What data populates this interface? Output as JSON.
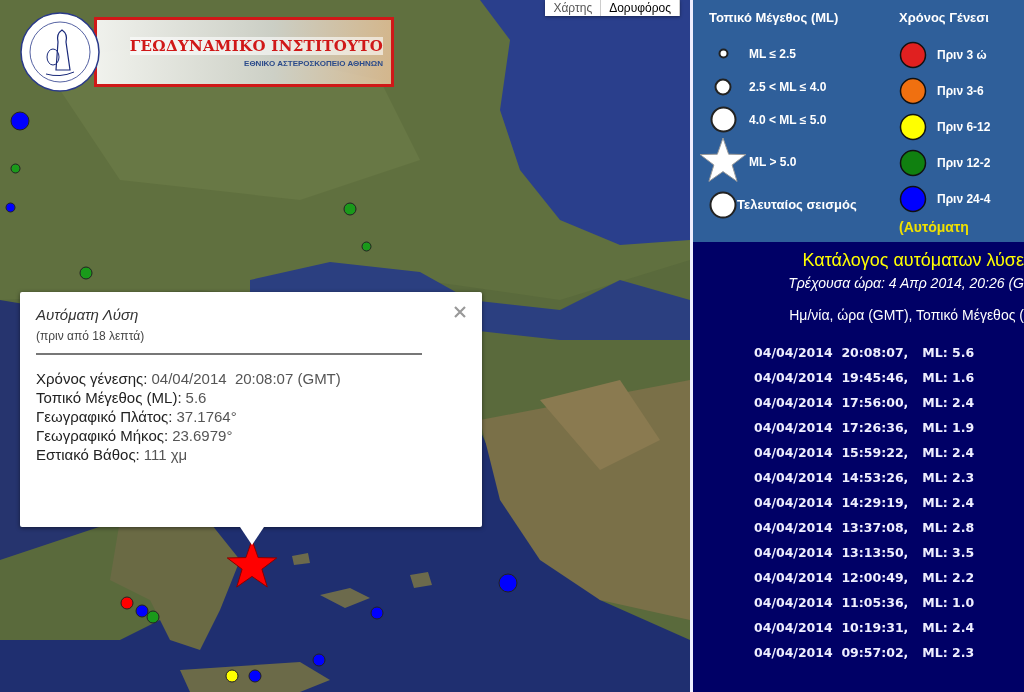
{
  "map": {
    "map_types": [
      {
        "label": "Χάρτης",
        "selected": false
      },
      {
        "label": "Δορυφόρος",
        "selected": true
      }
    ],
    "logo": {
      "title": "ΓΕΩΔΥΝΑΜΙΚΟ ΙΝΣΤΙΤΟΥΤΟ",
      "subtitle": "ΕΘΝΙΚΟ ΑΣΤΕΡΟΣΚΟΠΕΙΟ ΑΘΗΝΩΝ"
    },
    "markers": [
      {
        "kind": "large",
        "color": "#0000ff"
      },
      {
        "kind": "small",
        "color": "#1a9a1a"
      },
      {
        "kind": "small",
        "color": "#0000ff"
      },
      {
        "kind": "medium",
        "color": "#1a9a1a"
      },
      {
        "kind": "small",
        "color": "#1a9a1a"
      },
      {
        "kind": "medium",
        "color": "#1a9a1a"
      },
      {
        "kind": "large",
        "color": "#0000ff"
      },
      {
        "kind": "medium",
        "color": "#ff0000"
      },
      {
        "kind": "medium",
        "color": "#0000ff"
      },
      {
        "kind": "medium",
        "color": "#1a9a1a"
      },
      {
        "kind": "medium",
        "color": "#0000ff"
      },
      {
        "kind": "medium",
        "color": "#0000ff"
      },
      {
        "kind": "medium",
        "color": "#0000ff"
      },
      {
        "kind": "medium",
        "color": "#ffff00"
      },
      {
        "kind": "star",
        "color": "#ff0000"
      }
    ],
    "popup": {
      "title": "Αυτόματη Λύση",
      "subtitle": "(πριν από 18 λεπτά)",
      "fields": [
        {
          "label": "Χρόνος γένεσης:",
          "value": "04/04/2014  20:08:07 (GMT)"
        },
        {
          "label": "Τοπικό Μέγεθος (ML):",
          "value": "5.6"
        },
        {
          "label": "Γεωγραφικό Πλάτος:",
          "value": "37.1764°"
        },
        {
          "label": "Γεωγραφικό Μήκος:",
          "value": "23.6979°"
        },
        {
          "label": "Εστιακό Βάθος:",
          "value": "111 χμ"
        }
      ]
    }
  },
  "legend": {
    "magnitude_title": "Τοπικό Μέγεθος (ML)",
    "magnitudes": [
      {
        "kind": "small",
        "label": "ML ≤ 2.5"
      },
      {
        "kind": "medium",
        "label": "2.5 < ML ≤ 4.0"
      },
      {
        "kind": "large",
        "label": "4.0 < ML ≤ 5.0"
      },
      {
        "kind": "star",
        "label": "ML > 5.0"
      }
    ],
    "latest": "Τελευταίος σεισμός",
    "age_title": "Χρόνος Γένεσι",
    "ages": [
      {
        "label": "Πριν 3 ώ",
        "color": "#e02020"
      },
      {
        "label": "Πριν 3-6",
        "color": "#f07010"
      },
      {
        "label": "Πριν 6-12",
        "color": "#ffff00"
      },
      {
        "label": "Πριν 12-2",
        "color": "#108010"
      },
      {
        "label": "Πριν 24-4",
        "color": "#0000ff"
      }
    ],
    "note": "(Αυτόματη"
  },
  "catalog": {
    "title": "Κατάλογος αυτόματων λύσε",
    "current_time": "Τρέχουσα ώρα: 4 Απρ 2014, 20:26 (G",
    "header": "Ημ/νία, ώρα (GMT), Τοπικό Μέγεθος (",
    "rows": [
      {
        "datetime": "04/04/2014  20:08:07,",
        "ml": "ML: 5.6"
      },
      {
        "datetime": "04/04/2014  19:45:46,",
        "ml": "ML: 1.6"
      },
      {
        "datetime": "04/04/2014  17:56:00,",
        "ml": "ML: 2.4"
      },
      {
        "datetime": "04/04/2014  17:26:36,",
        "ml": "ML: 1.9"
      },
      {
        "datetime": "04/04/2014  15:59:22,",
        "ml": "ML: 2.4"
      },
      {
        "datetime": "04/04/2014  14:53:26,",
        "ml": "ML: 2.3"
      },
      {
        "datetime": "04/04/2014  14:29:19,",
        "ml": "ML: 2.4"
      },
      {
        "datetime": "04/04/2014  13:37:08,",
        "ml": "ML: 2.8"
      },
      {
        "datetime": "04/04/2014  13:13:50,",
        "ml": "ML: 3.5"
      },
      {
        "datetime": "04/04/2014  12:00:49,",
        "ml": "ML: 2.2"
      },
      {
        "datetime": "04/04/2014  11:05:36,",
        "ml": "ML: 1.0"
      },
      {
        "datetime": "04/04/2014  10:19:31,",
        "ml": "ML: 2.4"
      },
      {
        "datetime": "04/04/2014  09:57:02,",
        "ml": "ML: 2.3"
      }
    ]
  }
}
